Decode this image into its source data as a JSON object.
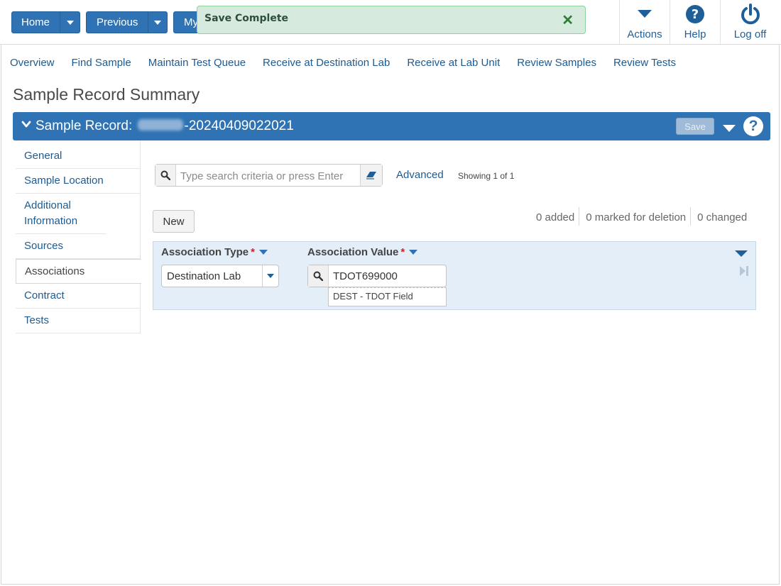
{
  "toolbar": {
    "home_label": "Home",
    "previous_label": "Previous",
    "my_label": "My"
  },
  "toast": {
    "message": "Save Complete",
    "close_glyph": "✕"
  },
  "top_icons": [
    {
      "label": "Actions",
      "icon": "caret-down-icon"
    },
    {
      "label": "Help",
      "icon": "question-circle-icon"
    },
    {
      "label": "Log off",
      "icon": "power-icon"
    }
  ],
  "nav": {
    "links": [
      "Overview",
      "Find Sample",
      "Maintain Test Queue",
      "Receive at Destination Lab",
      "Receive at Lab Unit",
      "Review Samples",
      "Review Tests"
    ]
  },
  "page": {
    "title": "Sample Record Summary"
  },
  "panel": {
    "title_prefix": "Sample Record:",
    "title_suffix": "-20240409022021",
    "save_label": "Save",
    "help_glyph": "?"
  },
  "sidebar": {
    "tabs": [
      "General",
      "Sample Location",
      "Additional Information",
      "Sources",
      "Associations",
      "Contract",
      "Tests"
    ],
    "active": "Associations"
  },
  "search": {
    "placeholder": "Type search criteria or press Enter",
    "advanced_label": "Advanced",
    "showing_text": "Showing 1 of 1"
  },
  "grid": {
    "new_label": "New",
    "added_text": "0 added",
    "deleted_text": "0 marked for deletion",
    "changed_text": "0 changed",
    "columns": {
      "type_header": "Association Type",
      "value_header": "Association Value",
      "required_mark": "*"
    },
    "row": {
      "type_value": "Destination Lab",
      "value_value": "TDOT699000",
      "value_description": "DEST - TDOT Field"
    }
  },
  "colors": {
    "primary": "#2f73b4",
    "link": "#1f5a8f",
    "toast_bg": "#d6ebdd",
    "row_bg": "#e3eef9",
    "required": "#c0282d"
  }
}
